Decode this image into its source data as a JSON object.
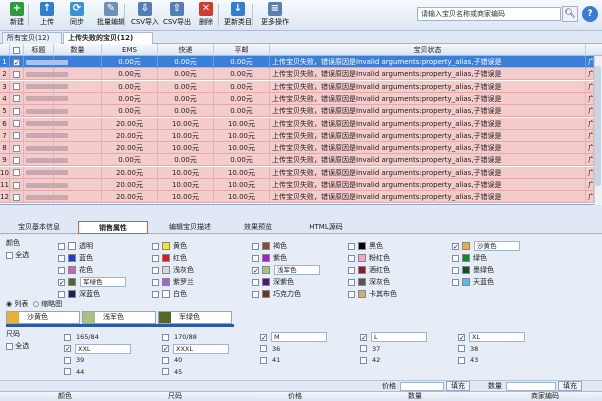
{
  "toolbar": {
    "buttons": [
      {
        "label": "新建",
        "icon": "new-icon",
        "color": "#2e9b3a",
        "glyph": "+"
      },
      {
        "label": "上传",
        "icon": "upload-icon",
        "color": "#2f7fd3",
        "glyph": "↑"
      },
      {
        "label": "同步",
        "icon": "sync-icon",
        "color": "#3a92d8",
        "glyph": "⟳"
      },
      {
        "label": "批量编辑",
        "icon": "batch-edit-icon",
        "color": "#6f8fb5",
        "glyph": "✎"
      },
      {
        "label": "CSV导入",
        "icon": "csv-import-icon",
        "color": "#4f7fb8",
        "glyph": "⇩"
      },
      {
        "label": "CSV导出",
        "icon": "csv-export-icon",
        "color": "#4f7fb8",
        "glyph": "⇧"
      },
      {
        "label": "删除",
        "icon": "delete-icon",
        "color": "#d43a2a",
        "glyph": "✕"
      },
      {
        "label": "更新类目",
        "icon": "update-category-icon",
        "color": "#2f7fd3",
        "glyph": "↓"
      },
      {
        "label": "更多操作",
        "icon": "more-icon",
        "color": "#5a7fae",
        "glyph": "≡"
      }
    ],
    "search_placeholder": "请输入宝贝名称或商家编码",
    "help": "?"
  },
  "view_tabs": [
    {
      "label": "所有宝贝(12)"
    },
    {
      "label": "上传失败的宝贝(12)"
    }
  ],
  "grid": {
    "columns": [
      "标题",
      "数量",
      "EMS",
      "快递",
      "平邮",
      "宝贝状态"
    ],
    "rows": [
      {
        "num": "1",
        "qty": "",
        "ems": "0.00元",
        "express": "0.00元",
        "post": "0.00元",
        "status": "上传宝贝失败，错误原因是Invalid arguments:property_alias,子错误是"
      },
      {
        "num": "2",
        "qty": "",
        "ems": "0.00元",
        "express": "0.00元",
        "post": "0.00元",
        "status": "上传宝贝失败，错误原因是Invalid arguments:property_alias,子错误是"
      },
      {
        "num": "3",
        "qty": "",
        "ems": "0.00元",
        "express": "0.00元",
        "post": "0.00元",
        "status": "上传宝贝失败，错误原因是Invalid arguments:property_alias,子错误是"
      },
      {
        "num": "4",
        "qty": "",
        "ems": "0.00元",
        "express": "0.00元",
        "post": "0.00元",
        "status": "上传宝贝失败，错误原因是Invalid arguments:property_alias,子错误是"
      },
      {
        "num": "5",
        "qty": "",
        "ems": "0.00元",
        "express": "0.00元",
        "post": "0.00元",
        "status": "上传宝贝失败，错误原因是Invalid arguments:property_alias,子错误是"
      },
      {
        "num": "6",
        "qty": "",
        "ems": "20.00元",
        "express": "10.00元",
        "post": "10.00元",
        "status": "上传宝贝失败，错误原因是Invalid arguments:property_alias,子错误是"
      },
      {
        "num": "7",
        "qty": "",
        "ems": "20.00元",
        "express": "10.00元",
        "post": "10.00元",
        "status": "上传宝贝失败，错误原因是Invalid arguments:property_alias,子错误是"
      },
      {
        "num": "8",
        "qty": "",
        "ems": "20.00元",
        "express": "10.00元",
        "post": "10.00元",
        "status": "上传宝贝失败，错误原因是Invalid arguments:property_alias,子错误是"
      },
      {
        "num": "9",
        "qty": "",
        "ems": "0.00元",
        "express": "0.00元",
        "post": "0.00元",
        "status": "上传宝贝失败，错误原因是Invalid arguments:property_alias,子错误是"
      },
      {
        "num": "10",
        "qty": "",
        "ems": "20.00元",
        "express": "10.00元",
        "post": "10.00元",
        "status": "上传宝贝失败，错误原因是Invalid arguments:property_alias,子错误是"
      },
      {
        "num": "11",
        "qty": "",
        "ems": "20.00元",
        "express": "10.00元",
        "post": "10.00元",
        "status": "上传宝贝失败，错误原因是Invalid arguments:property_alias,子错误是"
      },
      {
        "num": "12",
        "qty": "",
        "ems": "20.00元",
        "express": "10.00元",
        "post": "10.00元",
        "status": "上传宝贝失败，错误原因是Invalid arguments:property_alias,子错误是"
      }
    ],
    "trailing_char": "广"
  },
  "detail_tabs": [
    {
      "label": "宝贝基本信息"
    },
    {
      "label": "销售属性"
    },
    {
      "label": "编辑宝贝描述"
    },
    {
      "label": "效果预览"
    },
    {
      "label": "HTML源码"
    }
  ],
  "sale_attr": {
    "color_label": "颜色",
    "select_all": "全选",
    "colors": [
      {
        "name": "透明",
        "color": "#ffffff",
        "checked": false,
        "alias": ""
      },
      {
        "name": "黄色",
        "color": "#f2e81e",
        "checked": false,
        "alias": ""
      },
      {
        "name": "褐色",
        "color": "#8b4a2a",
        "checked": false,
        "alias": ""
      },
      {
        "name": "黑色",
        "color": "#000000",
        "checked": false,
        "alias": ""
      },
      {
        "name": "沙黄色",
        "color": "#e8b23a",
        "checked": true,
        "alias": "沙黄色"
      },
      {
        "name": "蓝色",
        "color": "#1e3cd8",
        "checked": false,
        "alias": ""
      },
      {
        "name": "红色",
        "color": "#e01818",
        "checked": false,
        "alias": ""
      },
      {
        "name": "紫色",
        "color": "#a020c0",
        "checked": false,
        "alias": ""
      },
      {
        "name": "粉红色",
        "color": "#f3a6c8",
        "checked": false,
        "alias": ""
      },
      {
        "name": "绿色",
        "color": "#118a2a",
        "checked": false,
        "alias": ""
      },
      {
        "name": "花色",
        "color": "#c86ab0",
        "checked": false,
        "alias": ""
      },
      {
        "name": "浅灰色",
        "color": "#d6d6d6",
        "checked": false,
        "alias": ""
      },
      {
        "name": "浅军色",
        "color": "#a8c080",
        "checked": true,
        "alias": "浅军色"
      },
      {
        "name": "酒红色",
        "color": "#8c1a2a",
        "checked": false,
        "alias": ""
      },
      {
        "name": "墨绿色",
        "color": "#1f4a2e",
        "checked": false,
        "alias": ""
      },
      {
        "name": "军绿色",
        "color": "#55682a",
        "checked": true,
        "alias": "军绿色"
      },
      {
        "name": "紫罗兰",
        "color": "#9a6ad0",
        "checked": false,
        "alias": ""
      },
      {
        "name": "深紫色",
        "color": "#4a1a7a",
        "checked": false,
        "alias": ""
      },
      {
        "name": "深灰色",
        "color": "#555555",
        "checked": false,
        "alias": ""
      },
      {
        "name": "天蓝色",
        "color": "#58b8f0",
        "checked": false,
        "alias": ""
      },
      {
        "name": "深蓝色",
        "color": "#12226a",
        "checked": false,
        "alias": ""
      },
      {
        "name": "白色",
        "color": "#ffffff",
        "checked": false,
        "alias": ""
      },
      {
        "name": "巧克力色",
        "color": "#6a3a1a",
        "checked": false,
        "alias": ""
      },
      {
        "name": "卡其布色",
        "color": "#c8b07a",
        "checked": false,
        "alias": ""
      }
    ],
    "view_list": "列表",
    "view_thumb": "缩略图",
    "chips": [
      {
        "name": "沙黄色",
        "color": "#e8b23a"
      },
      {
        "name": "浅军色",
        "color": "#a8c080"
      },
      {
        "name": "军绿色",
        "color": "#55682a"
      }
    ],
    "size_label": "尺码",
    "sizes": [
      {
        "name": "165/84",
        "checked": false,
        "alias": ""
      },
      {
        "name": "170/88",
        "checked": false,
        "alias": ""
      },
      {
        "name": "M",
        "checked": true,
        "alias": "M"
      },
      {
        "name": "L",
        "checked": true,
        "alias": "L"
      },
      {
        "name": "XL",
        "checked": true,
        "alias": "XL"
      },
      {
        "name": "XXL",
        "checked": true,
        "alias": "XXL"
      },
      {
        "name": "XXXL",
        "checked": true,
        "alias": "XXXL"
      },
      {
        "name": "36",
        "checked": false,
        "alias": ""
      },
      {
        "name": "37",
        "checked": false,
        "alias": ""
      },
      {
        "name": "38",
        "checked": false,
        "alias": ""
      },
      {
        "name": "39",
        "checked": false,
        "alias": ""
      },
      {
        "name": "40",
        "checked": false,
        "alias": ""
      },
      {
        "name": "41",
        "checked": false,
        "alias": ""
      },
      {
        "name": "42",
        "checked": false,
        "alias": ""
      },
      {
        "name": "43",
        "checked": false,
        "alias": ""
      },
      {
        "name": "44",
        "checked": false,
        "alias": ""
      },
      {
        "name": "45",
        "checked": false,
        "alias": ""
      }
    ],
    "price_label": "价格",
    "qty_label": "数量",
    "fill_label": "填充",
    "table_head": [
      "颜色",
      "尺码",
      "价格",
      "数量",
      "商家编码"
    ]
  }
}
